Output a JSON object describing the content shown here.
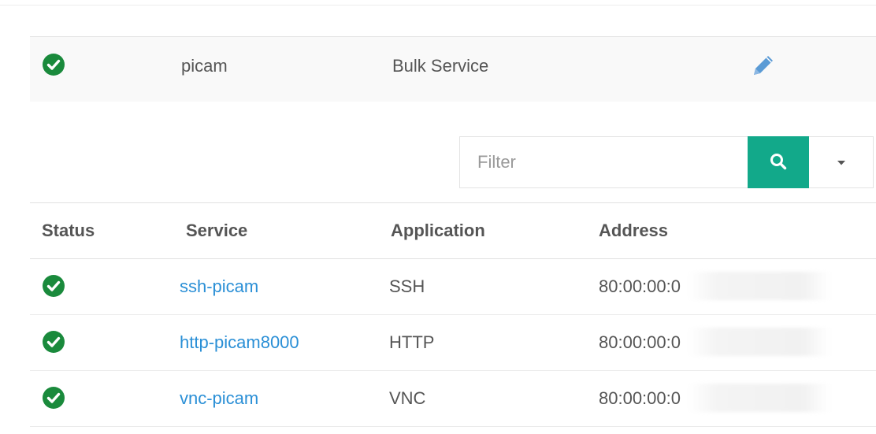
{
  "device": {
    "name": "picam",
    "type": "Bulk Service"
  },
  "filter": {
    "placeholder": "Filter"
  },
  "table": {
    "headers": {
      "status": "Status",
      "service": "Service",
      "application": "Application",
      "address": "Address"
    },
    "rows": [
      {
        "service": "ssh-picam",
        "application": "SSH",
        "address": "80:00:00:0"
      },
      {
        "service": "http-picam8000",
        "application": "HTTP",
        "address": "80:00:00:0"
      },
      {
        "service": "vnc-picam",
        "application": "VNC",
        "address": "80:00:00:0"
      }
    ]
  },
  "colors": {
    "status_ok": "#1a8a3c",
    "accent": "#12a98a",
    "link": "#2a8fd6",
    "edit_icon": "#5b9bd5"
  },
  "icons": {
    "status": "check-circle-icon",
    "edit": "pencil-icon",
    "search": "search-icon",
    "dropdown": "caret-down-icon"
  }
}
